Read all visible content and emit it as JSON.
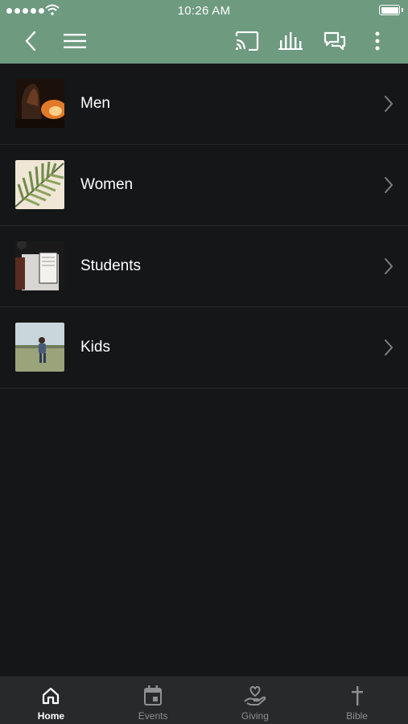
{
  "status_bar": {
    "time": "10:26 AM"
  },
  "nav": {
    "icons": [
      "back-icon",
      "menu-icon",
      "cast-icon",
      "audio-bars-icon",
      "chat-icon",
      "more-vertical-icon"
    ],
    "background": "#6e9a80"
  },
  "groups": [
    {
      "label": "Men"
    },
    {
      "label": "Women"
    },
    {
      "label": "Students"
    },
    {
      "label": "Kids"
    }
  ],
  "tabs": [
    {
      "label": "Home",
      "icon": "home-icon",
      "active": true
    },
    {
      "label": "Events",
      "icon": "calendar-icon",
      "active": false
    },
    {
      "label": "Giving",
      "icon": "giving-hand-heart-icon",
      "active": false
    },
    {
      "label": "Bible",
      "icon": "cross-icon",
      "active": false
    }
  ],
  "colors": {
    "background": "#151617",
    "tabbar": "#27292b",
    "active_tab": "#ffffff",
    "inactive_tab": "#8e9092"
  }
}
